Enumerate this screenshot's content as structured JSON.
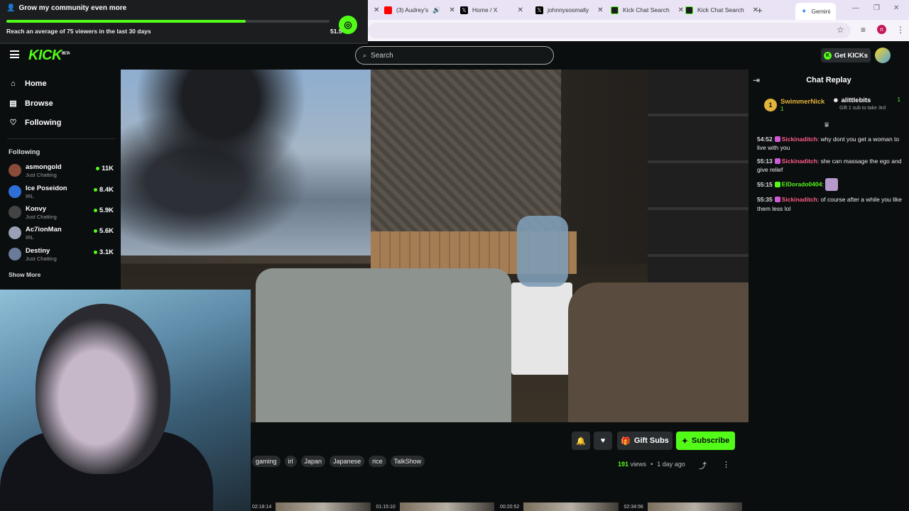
{
  "browser": {
    "tabs": [
      {
        "label": "(3) Audrey's",
        "color": "#ff0000"
      },
      {
        "label": "Home / X",
        "color": "#000000"
      },
      {
        "label": "johnnysosmally",
        "color": "#000000"
      },
      {
        "label": "Kick Chat Search",
        "color": "#1b1d1e"
      },
      {
        "label": "Kick Chat Search",
        "color": "#1b1d1e"
      }
    ],
    "active_tab": "Gemini",
    "new_tab_symbol": "+",
    "profile_initial": "n"
  },
  "goal": {
    "title": "Grow my community even more",
    "description": "Reach an average of 75 viewers in the last 30 days",
    "value_text": "51.5",
    "progress_fraction": 0.74
  },
  "header": {
    "logo": "KICK",
    "logo_badge": "BETA",
    "search_placeholder": "Search",
    "get_kicks_label": "Get KICKs"
  },
  "sidebar": {
    "nav": [
      {
        "label": "Home",
        "icon": "home-icon"
      },
      {
        "label": "Browse",
        "icon": "browse-icon"
      },
      {
        "label": "Following",
        "icon": "heart-icon"
      }
    ],
    "following_heading": "Following",
    "following": [
      {
        "name": "asmongold",
        "category": "Just Chatting",
        "viewers": "11K",
        "avatar_color": "#8a4b3a"
      },
      {
        "name": "Ice Poseidon",
        "category": "IRL",
        "viewers": "8.4K",
        "avatar_color": "#2f6fd8"
      },
      {
        "name": "Konvy",
        "category": "Just Chatting",
        "viewers": "5.9K",
        "avatar_color": "#444444"
      },
      {
        "name": "Ac7ionMan",
        "category": "IRL",
        "viewers": "5.6K",
        "avatar_color": "#9aa0b5"
      },
      {
        "name": "Destiny",
        "category": "Just Chatting",
        "viewers": "3.1K",
        "avatar_color": "#6a7a9a"
      }
    ],
    "show_more": "Show More"
  },
  "controls": {
    "gift_subs": "Gift Subs",
    "subscribe": "Subscribe",
    "tags": [
      "gaming",
      "irl",
      "Japan",
      "Japanese",
      "rice",
      "TalkShow"
    ],
    "views_count": "191",
    "views_label": "views",
    "separator": "•",
    "age": "1 day ago"
  },
  "chat": {
    "title": "Chat Replay",
    "leader_top": {
      "rank": "1",
      "name": "SwimmerNick",
      "count": "1"
    },
    "leader_next": {
      "name": "alittlebits",
      "count": "1",
      "note": "Gift 1 sub to take 3rd"
    },
    "messages": [
      {
        "time": "54:52",
        "user": "Sickinaditch",
        "user_color": "#ff5c8a",
        "text": "why dont you get a woman to live with you"
      },
      {
        "time": "55:13",
        "user": "Sickinaditch",
        "user_color": "#ff5c8a",
        "text": "she can massage the ego and give relief"
      },
      {
        "time": "55:15",
        "user": "ElDorado0404",
        "user_color": "#53fc18",
        "text": ""
      },
      {
        "time": "55:35",
        "user": "Sickinaditch",
        "user_color": "#ff5c8a",
        "text": "of course after a while you like them less lol"
      }
    ]
  },
  "thumbnails": [
    "02:18:14",
    "01:15:10",
    "00:20:52",
    "02:34:56"
  ]
}
